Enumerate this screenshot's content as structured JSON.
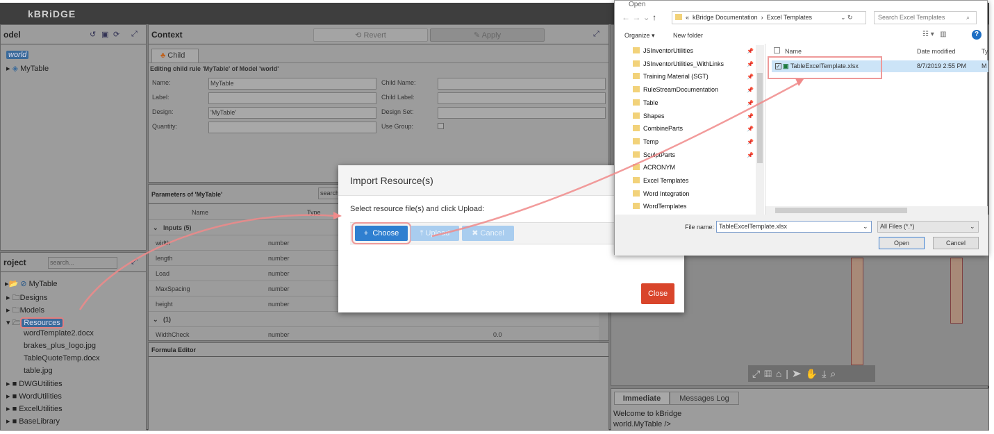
{
  "app": {
    "logo": "kBRiDGE"
  },
  "model_panel": {
    "title": "odel",
    "tree": [
      {
        "label": "world"
      },
      {
        "label": "MyTable"
      }
    ]
  },
  "context": {
    "title": "Context",
    "revert": "Revert",
    "apply": "Apply",
    "tab": "Child",
    "editing": "Editing child rule 'MyTable' of Model 'world'",
    "fields": {
      "name_label": "Name:",
      "name_value": "MyTable",
      "label_label": "Label:",
      "design_label": "Design:",
      "design_value": "'MyTable'",
      "quantity_label": "Quantity:",
      "child_name_label": "Child Name:",
      "child_label_label": "Child Label:",
      "design_set_label": "Design Set:",
      "use_group_label": "Use Group:"
    }
  },
  "parameters": {
    "title": "Parameters of 'MyTable'",
    "search_placeholder": "search...",
    "columns": [
      "Name",
      "Type"
    ],
    "group1": "Inputs (5)",
    "rows": [
      {
        "name": "width",
        "type": "number"
      },
      {
        "name": "length",
        "type": "number"
      },
      {
        "name": "Load",
        "type": "number"
      },
      {
        "name": "MaxSpacing",
        "type": "number"
      },
      {
        "name": "height",
        "type": "number"
      }
    ],
    "group2": "(1)",
    "row6": {
      "name": "WidthCheck",
      "type": "number",
      "value": "0.0"
    }
  },
  "formula": {
    "title": "Formula Editor"
  },
  "project": {
    "title": "roject",
    "search_placeholder": "search...",
    "tree": [
      "MyTable",
      "Designs",
      "Models",
      "Resources",
      "wordTemplate2.docx",
      "brakes_plus_logo.jpg",
      "TableQuoteTemp.docx",
      "table.jpg",
      "DWGUtilities",
      "WordUtilities",
      "ExcelUtilities",
      "BaseLibrary"
    ]
  },
  "console": {
    "tabs": [
      "Immediate",
      "Messages Log"
    ],
    "lines": [
      "Welcome to kBridge",
      "world.MyTable />"
    ]
  },
  "import_dialog": {
    "title": "Import Resource(s)",
    "instruction": "Select resource file(s) and click Upload:",
    "choose": "Choose",
    "upload": "Upload",
    "cancel": "Cancel",
    "close": "Close",
    "accent": "#2f7fd0",
    "close_color": "#d9452b"
  },
  "open_dialog": {
    "title": "Open",
    "breadcrumb": [
      "«",
      "kBridge Documentation",
      "Excel Templates"
    ],
    "search_placeholder": "Search Excel Templates",
    "organize": "Organize",
    "new_folder": "New folder",
    "folders": [
      "JSInventorUtilities",
      "JSInventorUtilities_WithLinks",
      "Training Material (SGT)",
      "RuleStreamDocumentation",
      "Table",
      "Shapes",
      "CombineParts",
      "Temp",
      "SculptParts",
      "ACRONYM",
      "Excel Templates",
      "Word Integration",
      "WordTemplates"
    ],
    "columns": [
      "Name",
      "Date modified",
      "Ty"
    ],
    "file": {
      "name": "TableExcelTemplate.xlsx",
      "date": "8/7/2019 2:55 PM",
      "type": "M"
    },
    "file_name_label": "File name:",
    "file_name_value": "TableExcelTemplate.xlsx",
    "filter": "All Files (*.*)",
    "open": "Open",
    "cancel": "Cancel"
  },
  "annotation_color": "#f08a8a"
}
